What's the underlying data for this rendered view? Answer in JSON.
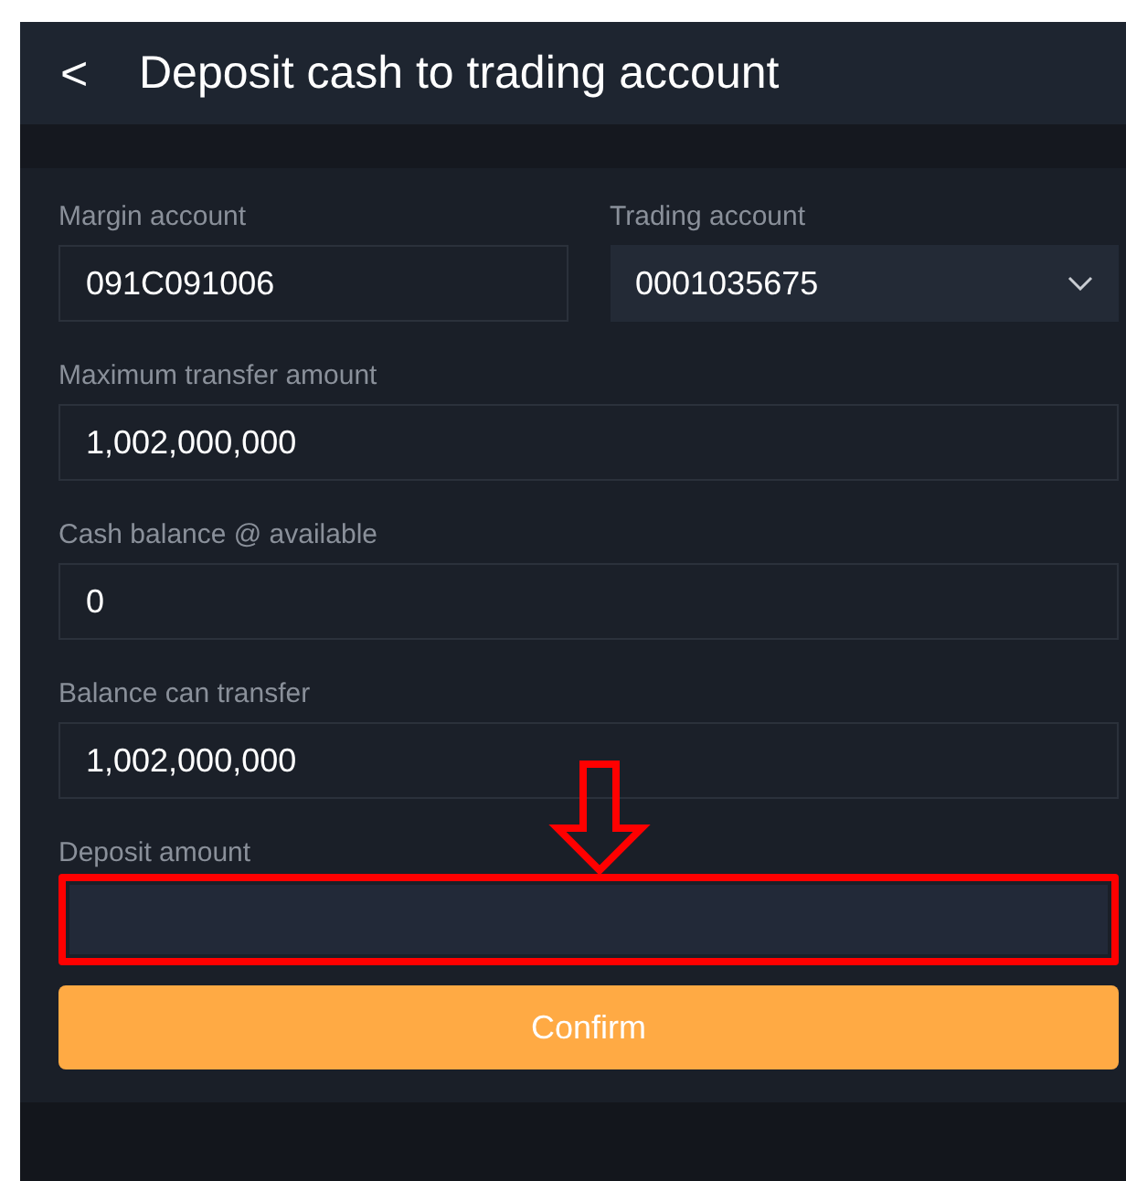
{
  "header": {
    "back_icon": "<",
    "title": "Deposit cash to trading account"
  },
  "rows": [
    [
      {
        "label": "Margin account",
        "value": "091C091006",
        "kind": "text",
        "highlighted": false
      },
      {
        "label": "Trading account",
        "value": "0001035675",
        "kind": "select",
        "highlighted": false
      }
    ],
    [
      {
        "label": "Maximum transfer amount",
        "value": "1,002,000,000",
        "kind": "text",
        "highlighted": false
      }
    ],
    [
      {
        "label": "Cash balance @ available",
        "value": "0",
        "kind": "text",
        "highlighted": false
      }
    ],
    [
      {
        "label": "Balance can transfer",
        "value": "1,002,000,000",
        "kind": "text",
        "highlighted": false
      }
    ],
    [
      {
        "label": "Deposit amount",
        "kind": "input",
        "highlighted": true
      }
    ]
  ],
  "confirm_button": "Confirm"
}
